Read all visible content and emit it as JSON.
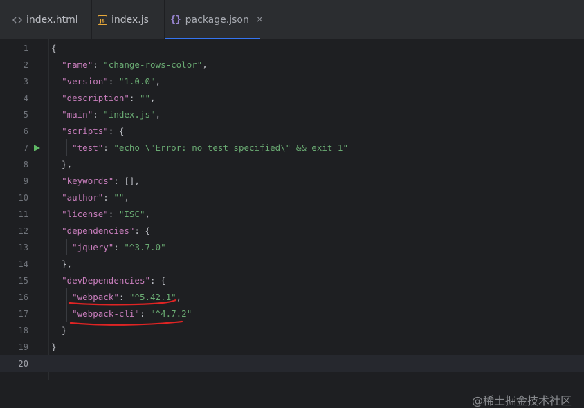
{
  "tabs": [
    {
      "label": "index.html",
      "icon": "code-icon"
    },
    {
      "label": "index.js",
      "icon": "js-file-icon"
    },
    {
      "label": "package.json",
      "icon": "json-braces-icon",
      "active": true,
      "close": "×"
    }
  ],
  "editor": {
    "file": "package.json",
    "lines": [
      {
        "n": "1",
        "tokens": [
          [
            "p",
            "{"
          ]
        ]
      },
      {
        "n": "2",
        "tokens": [
          [
            "p",
            "  "
          ],
          [
            "k",
            "\"name\""
          ],
          [
            "p",
            ": "
          ],
          [
            "s",
            "\"change-rows-color\""
          ],
          [
            "p",
            ","
          ]
        ]
      },
      {
        "n": "3",
        "tokens": [
          [
            "p",
            "  "
          ],
          [
            "k",
            "\"version\""
          ],
          [
            "p",
            ": "
          ],
          [
            "s",
            "\"1.0.0\""
          ],
          [
            "p",
            ","
          ]
        ]
      },
      {
        "n": "4",
        "tokens": [
          [
            "p",
            "  "
          ],
          [
            "k",
            "\"description\""
          ],
          [
            "p",
            ": "
          ],
          [
            "s",
            "\"\""
          ],
          [
            "p",
            ","
          ]
        ]
      },
      {
        "n": "5",
        "tokens": [
          [
            "p",
            "  "
          ],
          [
            "k",
            "\"main\""
          ],
          [
            "p",
            ": "
          ],
          [
            "s",
            "\"index.js\""
          ],
          [
            "p",
            ","
          ]
        ]
      },
      {
        "n": "6",
        "tokens": [
          [
            "p",
            "  "
          ],
          [
            "k",
            "\"scripts\""
          ],
          [
            "p",
            ": {"
          ]
        ]
      },
      {
        "n": "7",
        "run": true,
        "tokens": [
          [
            "p",
            "    "
          ],
          [
            "k",
            "\"test\""
          ],
          [
            "p",
            ": "
          ],
          [
            "s",
            "\"echo \\\"Error: no test specified\\\" && exit 1\""
          ]
        ]
      },
      {
        "n": "8",
        "tokens": [
          [
            "p",
            "  },"
          ]
        ]
      },
      {
        "n": "9",
        "tokens": [
          [
            "p",
            "  "
          ],
          [
            "k",
            "\"keywords\""
          ],
          [
            "p",
            ": [],"
          ]
        ]
      },
      {
        "n": "10",
        "tokens": [
          [
            "p",
            "  "
          ],
          [
            "k",
            "\"author\""
          ],
          [
            "p",
            ": "
          ],
          [
            "s",
            "\"\""
          ],
          [
            "p",
            ","
          ]
        ]
      },
      {
        "n": "11",
        "tokens": [
          [
            "p",
            "  "
          ],
          [
            "k",
            "\"license\""
          ],
          [
            "p",
            ": "
          ],
          [
            "s",
            "\"ISC\""
          ],
          [
            "p",
            ","
          ]
        ]
      },
      {
        "n": "12",
        "tokens": [
          [
            "p",
            "  "
          ],
          [
            "k",
            "\"dependencies\""
          ],
          [
            "p",
            ": {"
          ]
        ]
      },
      {
        "n": "13",
        "tokens": [
          [
            "p",
            "    "
          ],
          [
            "k",
            "\"jquery\""
          ],
          [
            "p",
            ": "
          ],
          [
            "s",
            "\"^3.7.0\""
          ]
        ]
      },
      {
        "n": "14",
        "tokens": [
          [
            "p",
            "  },"
          ]
        ]
      },
      {
        "n": "15",
        "tokens": [
          [
            "p",
            "  "
          ],
          [
            "k",
            "\"devDependencies\""
          ],
          [
            "p",
            ": {"
          ]
        ]
      },
      {
        "n": "16",
        "tokens": [
          [
            "p",
            "    "
          ],
          [
            "k",
            "\"webpack\""
          ],
          [
            "p",
            ": "
          ],
          [
            "s",
            "\"^5.42.1\""
          ],
          [
            "p",
            ","
          ]
        ]
      },
      {
        "n": "17",
        "tokens": [
          [
            "p",
            "    "
          ],
          [
            "k",
            "\"webpack-cli\""
          ],
          [
            "p",
            ": "
          ],
          [
            "s",
            "\"^4.7.2\""
          ]
        ]
      },
      {
        "n": "18",
        "tokens": [
          [
            "p",
            "  }"
          ]
        ]
      },
      {
        "n": "19",
        "tokens": [
          [
            "p",
            "}"
          ]
        ]
      },
      {
        "n": "20",
        "current": true,
        "tokens": []
      }
    ]
  },
  "watermark": "@稀土掘金技术社区",
  "colors": {
    "tab_bg": "#2b2d30",
    "editor_bg": "#1e1f22",
    "key": "#c77dbb",
    "string": "#6aab73",
    "accent": "#3574f0",
    "run": "#5fb865",
    "annotation": "#e02424"
  }
}
